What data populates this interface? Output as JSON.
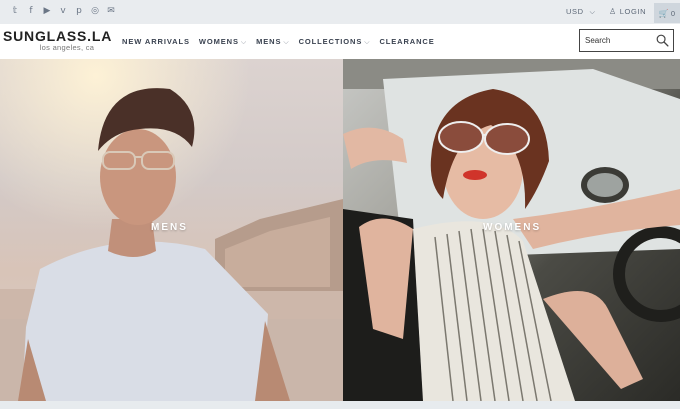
{
  "topbar": {
    "social": [
      {
        "icon": "twitter-icon",
        "glyph": "𝕥"
      },
      {
        "icon": "facebook-icon",
        "glyph": "f"
      },
      {
        "icon": "youtube-icon",
        "glyph": "▶"
      },
      {
        "icon": "vimeo-icon",
        "glyph": "v"
      },
      {
        "icon": "pinterest-icon",
        "glyph": "p"
      },
      {
        "icon": "instagram-icon",
        "glyph": "◎"
      },
      {
        "icon": "email-icon",
        "glyph": "✉"
      }
    ],
    "currency": "USD",
    "login": "LOGIN",
    "cart_count": "0"
  },
  "header": {
    "logo_name": "SUNGLASS.LA",
    "logo_tagline": "los angeles, ca",
    "nav": [
      {
        "label": "NEW ARRIVALS",
        "dropdown": false
      },
      {
        "label": "WOMENS",
        "dropdown": true
      },
      {
        "label": "MENS",
        "dropdown": true
      },
      {
        "label": "COLLECTIONS",
        "dropdown": true
      },
      {
        "label": "CLEARANCE",
        "dropdown": false
      }
    ],
    "search_placeholder": "Search"
  },
  "hero": {
    "left_label": "MENS",
    "right_label": "WOMENS"
  },
  "colors": {
    "topbar_bg": "#e9ecef",
    "nav_text": "#3a4250",
    "icon_grey": "#6b7686"
  }
}
